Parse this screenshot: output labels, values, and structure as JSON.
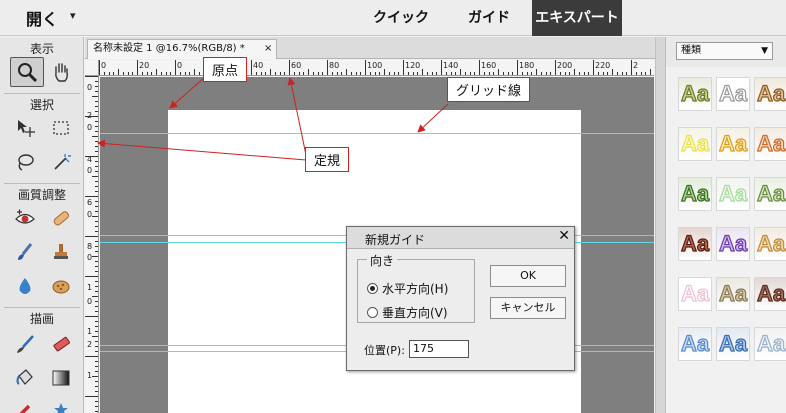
{
  "topbar": {
    "open_label": "開く",
    "open_caret": "▾",
    "modes": {
      "quick": "クイック",
      "guide": "ガイド",
      "expert": "エキスパート"
    }
  },
  "toolbox": {
    "sections": {
      "view": "表示",
      "select": "選択",
      "enhance": "画質調整",
      "draw": "描画"
    }
  },
  "document": {
    "tab_title": "名称未設定 1 @16.7%(RGB/8) *",
    "tab_close": "×"
  },
  "ruler": {
    "h_labels": [
      "0",
      "20",
      "0",
      "20",
      "40",
      "60",
      "80",
      "100",
      "120",
      "140",
      "160",
      "180",
      "200",
      "220",
      "2"
    ],
    "v_labels": [
      "0",
      "2",
      "0",
      "4",
      "0",
      "6",
      "0",
      "8",
      "0",
      "1",
      "0",
      "1",
      "2",
      "1"
    ]
  },
  "panel": {
    "dropdown_value": "種類",
    "tile_text": "Aa"
  },
  "dialog": {
    "title": "新規ガイド",
    "close": "✕",
    "orientation_legend": "向き",
    "horizontal_label": "水平方向(H)",
    "vertical_label": "垂直方向(V)",
    "ok_label": "OK",
    "cancel_label": "キャンセル",
    "position_label": "位置(P):",
    "position_value": "175"
  },
  "callouts": {
    "origin": "原点",
    "grid_line": "グリッド線",
    "ruler": "定規"
  },
  "colors": {
    "guide": "#5fd9e8",
    "callout_border": "#cc2222",
    "expert_tab": "#3b3b3b"
  }
}
